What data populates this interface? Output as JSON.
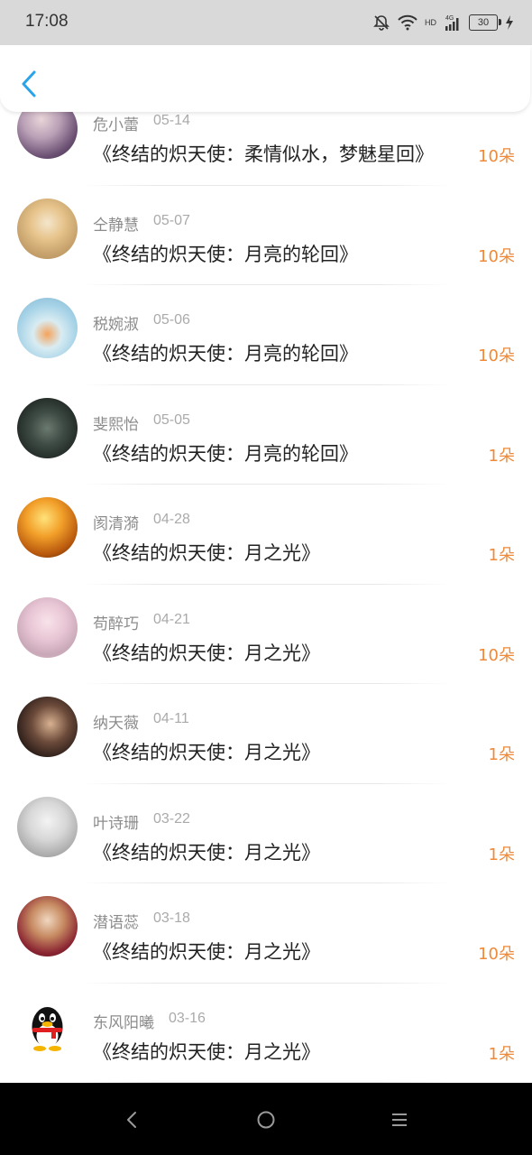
{
  "status_bar": {
    "time": "17:08",
    "network": "4G",
    "hd": "HD",
    "battery": "30"
  },
  "header": {
    "back_icon": "chevron-left-icon",
    "accent_color": "#2aa3e8"
  },
  "records": [
    {
      "name": "危小蕾",
      "date": "05-14",
      "title": "《终结的炽天使：柔情似水，梦魅星回》",
      "count": "10朵",
      "avatar": "avatar-girl-purple"
    },
    {
      "name": "仝静慧",
      "date": "05-07",
      "title": "《终结的炽天使：月亮的轮回》",
      "count": "10朵",
      "avatar": "avatar-cat"
    },
    {
      "name": "税婉淑",
      "date": "05-06",
      "title": "《终结的炽天使：月亮的轮回》",
      "count": "10朵",
      "avatar": "avatar-fishbowl"
    },
    {
      "name": "斐熙怡",
      "date": "05-05",
      "title": "《终结的炽天使：月亮的轮回》",
      "count": "1朵",
      "avatar": "avatar-birds"
    },
    {
      "name": "阂清漪",
      "date": "04-28",
      "title": "《终结的炽天使：月之光》",
      "count": "1朵",
      "avatar": "avatar-sunset"
    },
    {
      "name": "苟醉巧",
      "date": "04-21",
      "title": "《终结的炽天使：月之光》",
      "count": "10朵",
      "avatar": "avatar-flowers"
    },
    {
      "name": "纳天薇",
      "date": "04-11",
      "title": "《终结的炽天使：月之光》",
      "count": "1朵",
      "avatar": "avatar-girl-dark"
    },
    {
      "name": "叶诗珊",
      "date": "03-22",
      "title": "《终结的炽天使：月之光》",
      "count": "1朵",
      "avatar": "avatar-boy-white"
    },
    {
      "name": "潜语蕊",
      "date": "03-18",
      "title": "《终结的炽天使：月之光》",
      "count": "10朵",
      "avatar": "avatar-girl-red"
    },
    {
      "name": "东风阳曦",
      "date": "03-16",
      "title": "《终结的炽天使：月之光》",
      "count": "1朵",
      "avatar": "avatar-qq-penguin"
    }
  ],
  "colors": {
    "count": "#ee8a3a",
    "name": "#8c8c8c",
    "title": "#222222"
  },
  "nav_bar": {
    "back": "nav-back-icon",
    "home": "nav-home-icon",
    "menu": "nav-menu-icon"
  }
}
